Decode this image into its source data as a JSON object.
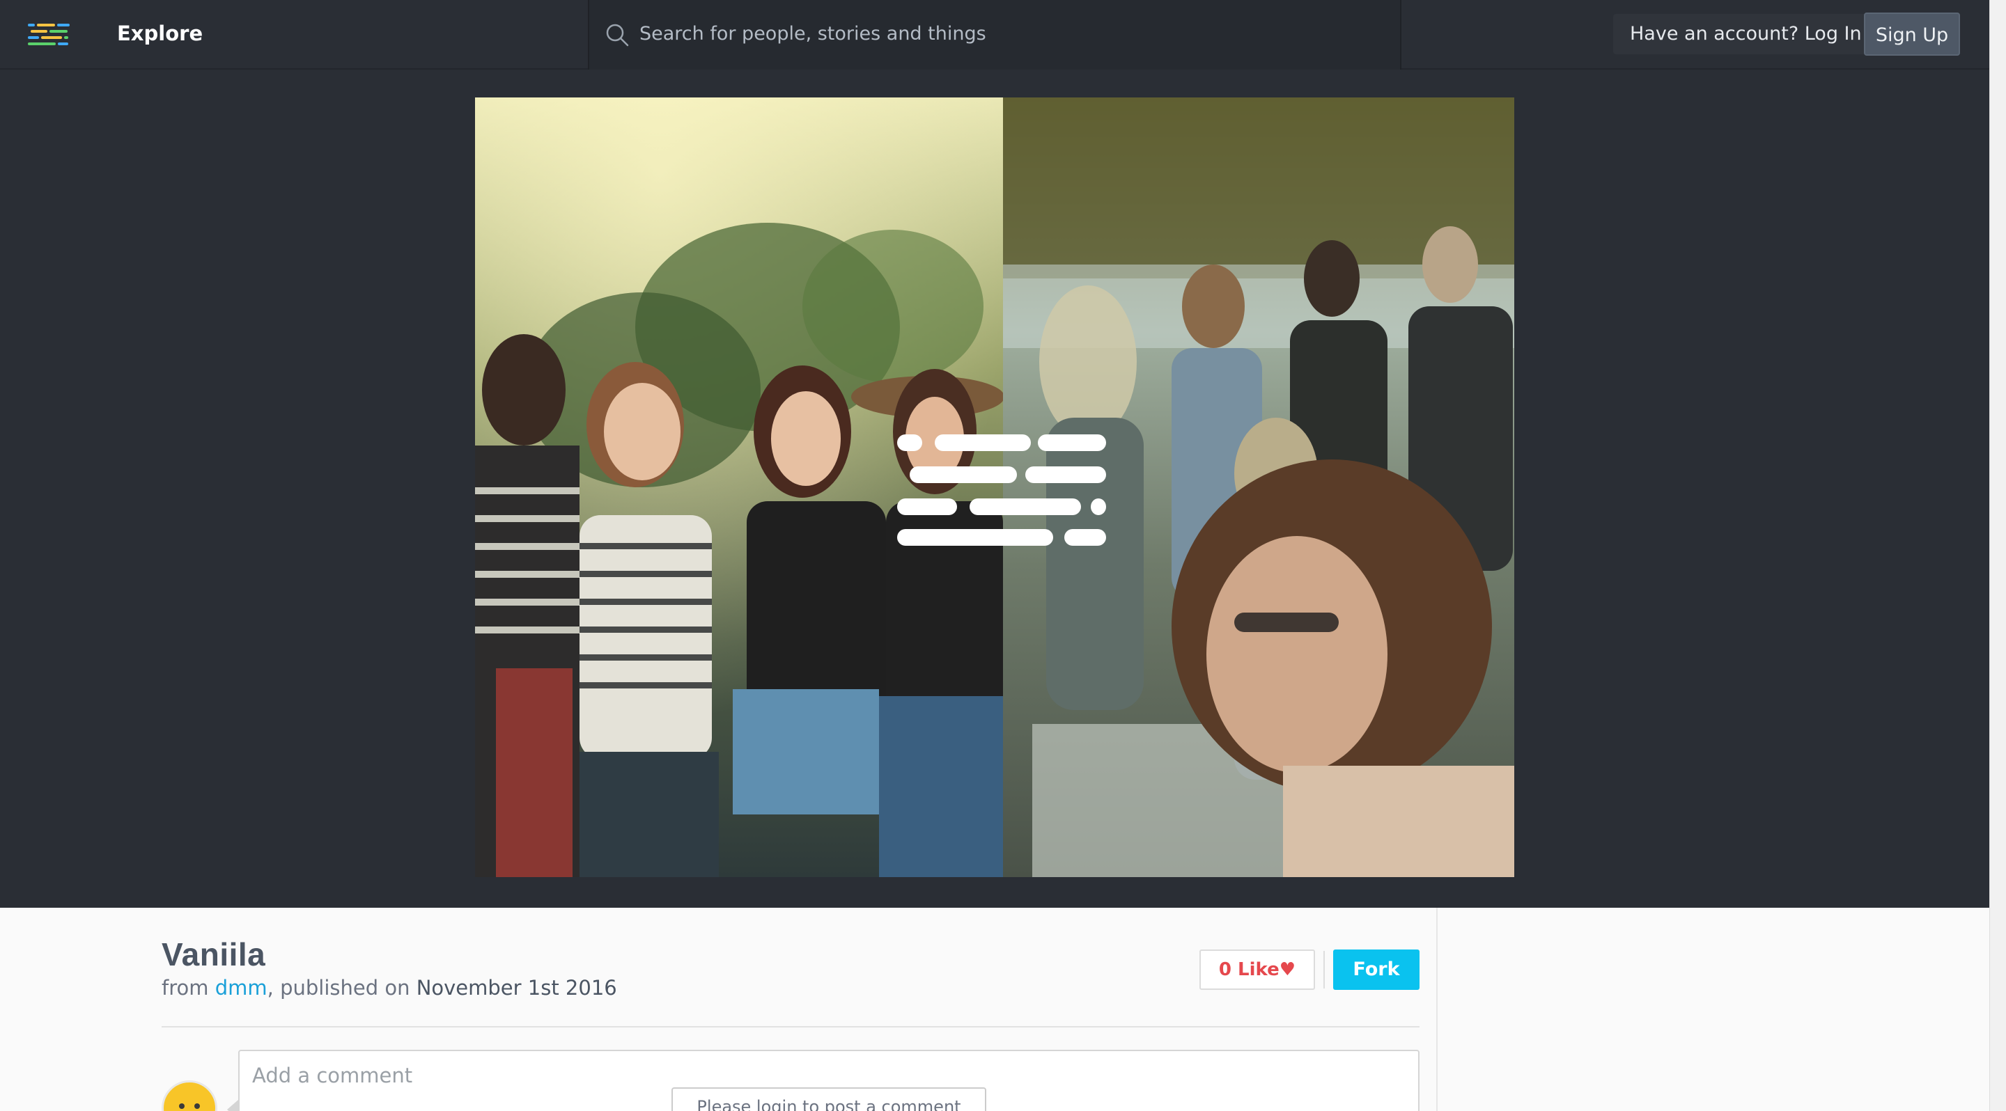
{
  "header": {
    "explore_label": "Explore",
    "search_placeholder": "Search for people, stories and things",
    "login_label": "Have an account? Log In",
    "signup_label": "Sign Up"
  },
  "story": {
    "title": "Vaniila",
    "from_prefix": "from ",
    "author": "dmm",
    "published_prefix": ", published on ",
    "date": "November 1st 2016",
    "like_label": "0 Like",
    "heart_glyph": "♥",
    "fork_label": "Fork"
  },
  "comment": {
    "placeholder": "Add a comment",
    "login_prompt": "Please login to post a comment"
  },
  "colors": {
    "background": "#2a2e35",
    "accent": "#0ac2ef",
    "link": "#1aa0d8",
    "like": "#e5484d"
  },
  "icons": {
    "logo": "lines-logo-icon",
    "search": "search-icon",
    "heart": "heart-icon"
  }
}
